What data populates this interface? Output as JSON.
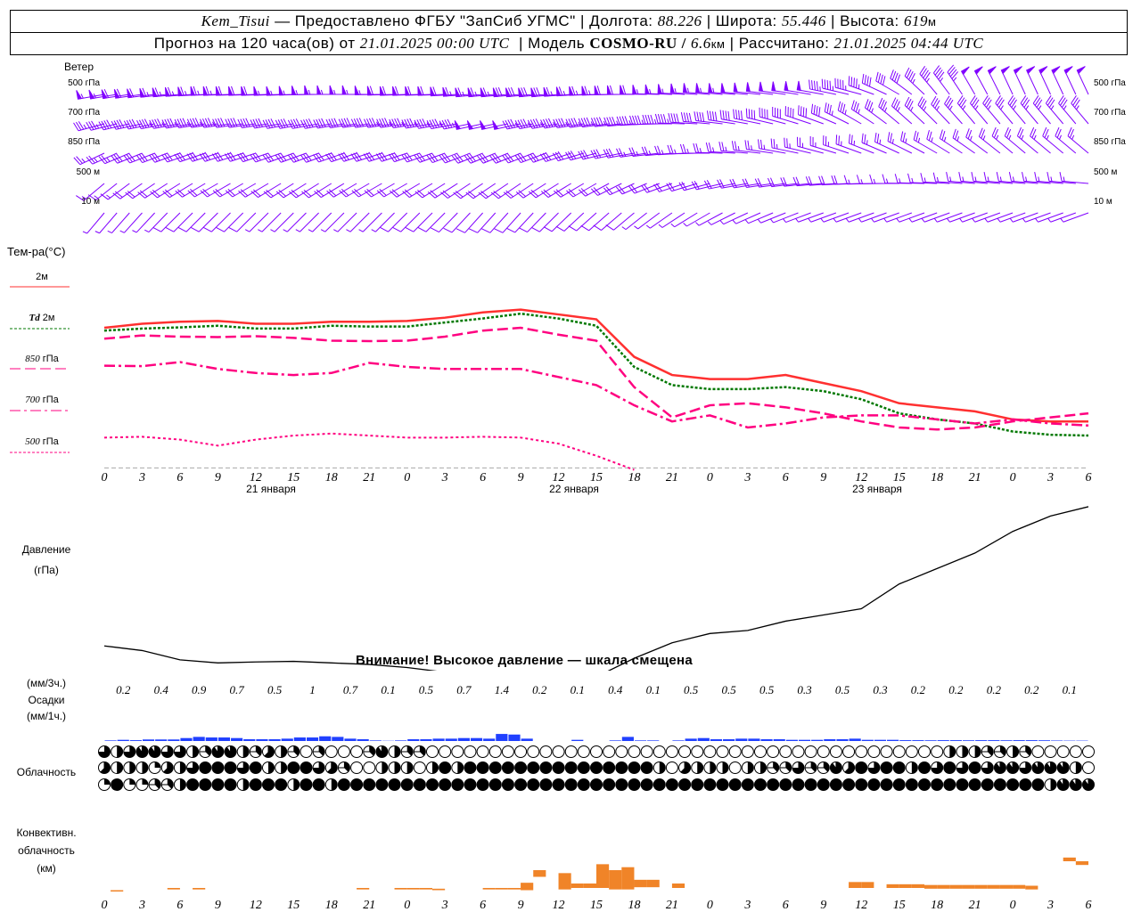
{
  "header": {
    "station": "Kem_Tisui",
    "provided": "— Предоставлено ФГБУ \"ЗапСиб УГМС\"",
    "lon_label": "Долгота:",
    "lon": "88.226",
    "lat_label": "Широта:",
    "lat": "55.446",
    "alt_label": "Высота:",
    "alt": "619",
    "alt_unit": "м",
    "forecast_label": "Прогноз на 120 часа(ов) от",
    "forecast_time": "21.01.2025 00:00 UTC",
    "model_label": "Модель",
    "model": "COSMO-RU /",
    "resolution": "6.6",
    "res_unit": "км",
    "calc_label": "Рассчитано:",
    "calc_time": "21.01.2025 04:44 UTC"
  },
  "labels": {
    "wind": "Ветер",
    "temp": "Тем-ра(°C)",
    "t2m": "2м",
    "td": "Td",
    "td2m": "2м",
    "t850": "850",
    "t700": "700",
    "t500": "500",
    "gpa": "гПа",
    "pressure": "Давление",
    "pressure_unit": "(гПа)",
    "pressure_warning": "Внимание! Высокое давление — шкала смещена",
    "precip3": "(мм/3ч.)",
    "precip": "Осадки",
    "precip1": "(мм/1ч.)",
    "cloud": "Облачность",
    "conv1": "Конвективн.",
    "conv2": "облачность",
    "conv3": "(км)"
  },
  "wind_levels": [
    "500 гПа",
    "700 гПа",
    "850 гПа",
    "500 м",
    "10 м"
  ],
  "colors": {
    "t2m": "#ff3030",
    "td": "#007800",
    "t850": "#ff0080",
    "t700": "#ff0080",
    "t500": "#ff0080",
    "zero": "#2040ff",
    "wind": "#8000ff",
    "precip": "#2040ff",
    "conv": "#f08428",
    "pressure": "#000000"
  },
  "time_axis": {
    "hours_step": 3,
    "labels": [
      "0",
      "3",
      "6",
      "9",
      "12",
      "15",
      "18",
      "21",
      "0",
      "3",
      "6",
      "9",
      "12",
      "15",
      "18",
      "21",
      "0",
      "3",
      "6",
      "9",
      "12",
      "15",
      "18",
      "21",
      "0",
      "3",
      "6"
    ],
    "days": [
      "21 января",
      "22 января",
      "23 января"
    ]
  },
  "wind": [
    {
      "level": "500 гПа",
      "dir": [
        260,
        262,
        265,
        268,
        268,
        268,
        270,
        270,
        268,
        268,
        265,
        265,
        265,
        268,
        270,
        272,
        275,
        275,
        278,
        280,
        285,
        300,
        320,
        330,
        335,
        335,
        335
      ],
      "speed": [
        28,
        30,
        32,
        32,
        30,
        28,
        28,
        28,
        30,
        30,
        32,
        34,
        34,
        32,
        30,
        28,
        28,
        26,
        26,
        24,
        22,
        20,
        22,
        24,
        26,
        26,
        26
      ]
    },
    {
      "level": "700 гПа",
      "dir": [
        255,
        258,
        260,
        262,
        262,
        260,
        260,
        262,
        262,
        260,
        258,
        258,
        260,
        262,
        265,
        270,
        275,
        280,
        285,
        290,
        300,
        310,
        315,
        320,
        320,
        320,
        320
      ],
      "speed": [
        18,
        20,
        22,
        22,
        20,
        20,
        20,
        20,
        22,
        22,
        24,
        24,
        22,
        22,
        22,
        22,
        20,
        20,
        20,
        20,
        18,
        18,
        18,
        18,
        18,
        18,
        18
      ]
    },
    {
      "level": "850 гПа",
      "dir": [
        245,
        248,
        250,
        252,
        252,
        250,
        250,
        252,
        252,
        250,
        248,
        248,
        250,
        255,
        260,
        265,
        270,
        275,
        280,
        285,
        290,
        295,
        300,
        305,
        310,
        310,
        310
      ],
      "speed": [
        12,
        14,
        15,
        15,
        14,
        14,
        14,
        14,
        15,
        15,
        16,
        16,
        15,
        14,
        14,
        12,
        12,
        12,
        12,
        12,
        12,
        12,
        12,
        12,
        12,
        12,
        12
      ]
    },
    {
      "level": "500 м",
      "dir": [
        230,
        235,
        238,
        240,
        240,
        238,
        238,
        240,
        240,
        238,
        236,
        236,
        238,
        240,
        245,
        250,
        255,
        260,
        262,
        265,
        268,
        270,
        272,
        275,
        275,
        275,
        275
      ],
      "speed": [
        8,
        9,
        10,
        10,
        9,
        9,
        9,
        9,
        10,
        10,
        11,
        11,
        10,
        10,
        10,
        9,
        9,
        9,
        9,
        9,
        9,
        8,
        8,
        8,
        8,
        8,
        8
      ]
    },
    {
      "level": "10 м",
      "dir": [
        220,
        222,
        225,
        225,
        225,
        225,
        225,
        225,
        225,
        225,
        222,
        222,
        225,
        228,
        230,
        235,
        240,
        245,
        248,
        250,
        250,
        250,
        250,
        250,
        250,
        250,
        250
      ],
      "speed": [
        3,
        3,
        4,
        4,
        4,
        3,
        3,
        3,
        4,
        4,
        4,
        4,
        4,
        4,
        4,
        3,
        3,
        3,
        3,
        3,
        3,
        3,
        3,
        3,
        3,
        3,
        3
      ]
    }
  ],
  "chart_data": [
    {
      "type": "line",
      "name": "temperature",
      "ylabel": "Тем-ра(°C)",
      "ylim": [
        -40,
        20
      ],
      "yticks_step": 5,
      "grid": true,
      "x_hours": [
        0,
        3,
        6,
        9,
        12,
        15,
        18,
        21,
        24,
        27,
        30,
        33,
        36,
        39,
        42,
        45,
        48,
        51,
        54,
        57,
        60,
        63,
        66,
        69,
        72,
        75,
        78
      ],
      "series": [
        {
          "name": "2м",
          "key": "t2m",
          "style": "solid",
          "values": [
            -5.3,
            -4.3,
            -3.8,
            -3.6,
            -4.3,
            -4.3,
            -3.8,
            -3.8,
            -3.6,
            -2.8,
            -1.5,
            -0.8,
            -2,
            -3.2,
            -12.5,
            -17,
            -18,
            -18,
            -17,
            -19,
            -21,
            -24,
            -25,
            -26,
            -28,
            -28.5,
            -28.5
          ]
        },
        {
          "name": "Td 2м",
          "key": "td",
          "style": "dotted",
          "values": [
            -6,
            -5.5,
            -5.2,
            -4.8,
            -5.5,
            -5.5,
            -4.8,
            -5,
            -5,
            -4,
            -3,
            -1.8,
            -3,
            -4.8,
            -15,
            -19.5,
            -20.5,
            -20.5,
            -20,
            -21,
            -23,
            -26.5,
            -28,
            -29,
            -31,
            -31.8,
            -32
          ]
        },
        {
          "name": "850 гПа",
          "key": "t850",
          "style": "dashed",
          "values": [
            -8,
            -7.2,
            -7.5,
            -7.6,
            -7.4,
            -7.8,
            -8.5,
            -8.6,
            -8.5,
            -7.5,
            -6,
            -5.3,
            -7,
            -8.5,
            -20,
            -27.5,
            -24.5,
            -24,
            -25,
            -26.5,
            -28.5,
            -30,
            -30.5,
            -30,
            -28.5,
            -27.5,
            -26.5
          ]
        },
        {
          "name": "700 гПа",
          "key": "t700",
          "style": "dashdot",
          "values": [
            -14.7,
            -14.8,
            -13.8,
            -15.5,
            -16.5,
            -17,
            -16.5,
            -14,
            -15,
            -15.5,
            -15.5,
            -15.5,
            -17.5,
            -19.5,
            -24.5,
            -28.5,
            -27,
            -30,
            -29,
            -27.5,
            -27,
            -27,
            -28,
            -29,
            -28,
            -29,
            -29.5
          ]
        },
        {
          "name": "500 гПа",
          "key": "t500",
          "style": "dotted",
          "values": [
            -32.5,
            -32.3,
            -33,
            -34.5,
            -33,
            -32,
            -31.5,
            -32,
            -32.5,
            -32.5,
            -32.3,
            -32.5,
            -34,
            -37,
            -40.5,
            null,
            null,
            null,
            null,
            null,
            null,
            null,
            null,
            null,
            null,
            null,
            null
          ]
        }
      ]
    },
    {
      "type": "line",
      "name": "pressure",
      "ylabel": "Давление (гПа)",
      "ylim": [
        1005,
        1060
      ],
      "yticks_step": 5,
      "grid": true,
      "x_hours": [
        0,
        3,
        6,
        9,
        12,
        15,
        18,
        21,
        24,
        27,
        30,
        33,
        36,
        39,
        42,
        45,
        48,
        51,
        54,
        57,
        60,
        63,
        66,
        69,
        72,
        75,
        78
      ],
      "values": [
        1013,
        1011.5,
        1008.5,
        1007.5,
        1007.8,
        1008,
        1007.5,
        1007,
        1006,
        1004.5,
        1003,
        1002,
        1001.5,
        1003,
        1009,
        1014,
        1017,
        1018,
        1021,
        1023,
        1025,
        1033,
        1038,
        1043,
        1050,
        1055,
        1058
      ]
    },
    {
      "type": "bar",
      "name": "precipitation",
      "ylabel": "Осадки (мм/1ч.)",
      "ylim": [
        0,
        5
      ],
      "yticks_step": 1,
      "totals_3h": [
        "0.2",
        "0.4",
        "0.9",
        "0.7",
        "0.5",
        "1",
        "0.7",
        "0.1",
        "0.5",
        "0.7",
        "1.4",
        "0.2",
        "0.1",
        "0.4",
        "0.1",
        "0.5",
        "0.5",
        "0.5",
        "0.3",
        "0.5",
        "0.3",
        "0.2",
        "0.2",
        "0.2",
        "0.2",
        "0.1"
      ],
      "hourly": [
        0.05,
        0.1,
        0.07,
        0.13,
        0.13,
        0.13,
        0.25,
        0.35,
        0.3,
        0.3,
        0.25,
        0.15,
        0.15,
        0.15,
        0.2,
        0.3,
        0.3,
        0.4,
        0.35,
        0.2,
        0.15,
        0.05,
        0.02,
        0.05,
        0.15,
        0.15,
        0.2,
        0.2,
        0.25,
        0.25,
        0.2,
        0.6,
        0.55,
        0.2,
        0,
        0,
        0,
        0.1,
        0,
        0,
        0.05,
        0.35,
        0.05,
        0.05,
        0,
        0.05,
        0.2,
        0.25,
        0.15,
        0.15,
        0.2,
        0.2,
        0.15,
        0.15,
        0.1,
        0.1,
        0.1,
        0.15,
        0.15,
        0.2,
        0.1,
        0.1,
        0.1,
        0.07,
        0.07,
        0.06,
        0.07,
        0.07,
        0.06,
        0.07,
        0.07,
        0.06,
        0.07,
        0.07,
        0.06,
        0.04,
        0.03,
        0.03
      ]
    },
    {
      "type": "table",
      "name": "cloudiness_octas",
      "rows": [
        "6467766437743543030003743300000000000000000000000000000000000000000444334300000",
        "5444254688868448865300444048488888888888888840544404433633758688486868677677740",
        "2822334888848884884888888888888888888888888888888888888888888888888888888884777"
      ]
    },
    {
      "type": "bar",
      "name": "convective_cloud",
      "ylabel": "Конвективн. облачность (км)",
      "ylim": [
        0,
        13
      ],
      "yticks_step": 2,
      "bars": [
        [
          0.5,
          0.8,
          0.9
        ],
        [
          5,
          1.0,
          1.2
        ],
        [
          7,
          1.0,
          1.2
        ],
        [
          20,
          1.0,
          1.2
        ],
        [
          23,
          1.0,
          1.2
        ],
        [
          24,
          1.0,
          1.2
        ],
        [
          25,
          1.0,
          1.2
        ],
        [
          26,
          0.9,
          1.1
        ],
        [
          30,
          1.0,
          1.2
        ],
        [
          31,
          1.0,
          1.2
        ],
        [
          32,
          1.0,
          1.2
        ],
        [
          33,
          0.9,
          1.9
        ],
        [
          34,
          2.7,
          3.6
        ],
        [
          36,
          1.0,
          3.2
        ],
        [
          37,
          1.2,
          1.8
        ],
        [
          38,
          1.2,
          1.8
        ],
        [
          39,
          1.2,
          4.4
        ],
        [
          40,
          1.0,
          3.6
        ],
        [
          41,
          1.0,
          4.0
        ],
        [
          42,
          1.3,
          2.3
        ],
        [
          43,
          1.3,
          2.3
        ],
        [
          45,
          1.2,
          1.8
        ],
        [
          59,
          1.2,
          2.0
        ],
        [
          60,
          1.2,
          2.0
        ],
        [
          62,
          1.2,
          1.7
        ],
        [
          63,
          1.2,
          1.7
        ],
        [
          64,
          1.2,
          1.7
        ],
        [
          65,
          1.1,
          1.6
        ],
        [
          66,
          1.1,
          1.6
        ],
        [
          67,
          1.1,
          1.6
        ],
        [
          68,
          1.1,
          1.6
        ],
        [
          69,
          1.1,
          1.6
        ],
        [
          70,
          1.1,
          1.6
        ],
        [
          71,
          1.1,
          1.6
        ],
        [
          72,
          1.1,
          1.6
        ],
        [
          73,
          1.0,
          1.5
        ],
        [
          76,
          4.8,
          5.3
        ],
        [
          77,
          4.3,
          4.8
        ]
      ]
    }
  ]
}
